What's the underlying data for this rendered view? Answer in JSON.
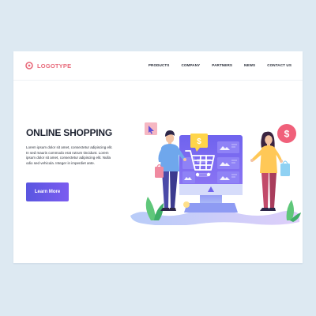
{
  "header": {
    "logo_text": "LOGOTYPE",
    "nav": [
      "PRODUCTS",
      "COMPANY",
      "PARTNERS",
      "NEWS",
      "CONTACT US"
    ]
  },
  "hero": {
    "title": "ONLINE SHOPPING",
    "text": "Lorem ipsum dolor sit amet, consectetur adipiscing elit. In sed mauris commodo erat rutrum tincidunt. Lorem ipsum dolor sit amet, consectetur adipiscing elit. Nulla odio sed vehicula. Integer in imperdiet ante.",
    "cta_label": "Learn More"
  },
  "illustration": {
    "price_tag": "$",
    "coin_symbol": "$",
    "icons": [
      "cursor-icon",
      "dollar-coin-icon",
      "shopping-cart-icon",
      "image-icon",
      "shopping-bag-icon",
      "plant-icon"
    ]
  },
  "colors": {
    "background": "#dde9f2",
    "logo": "#e86a7a",
    "accent": "#6a5ae8",
    "monitor_screen": "#7a6cf2",
    "coin": "#f0607a",
    "price_tag": "#ffd54a"
  }
}
